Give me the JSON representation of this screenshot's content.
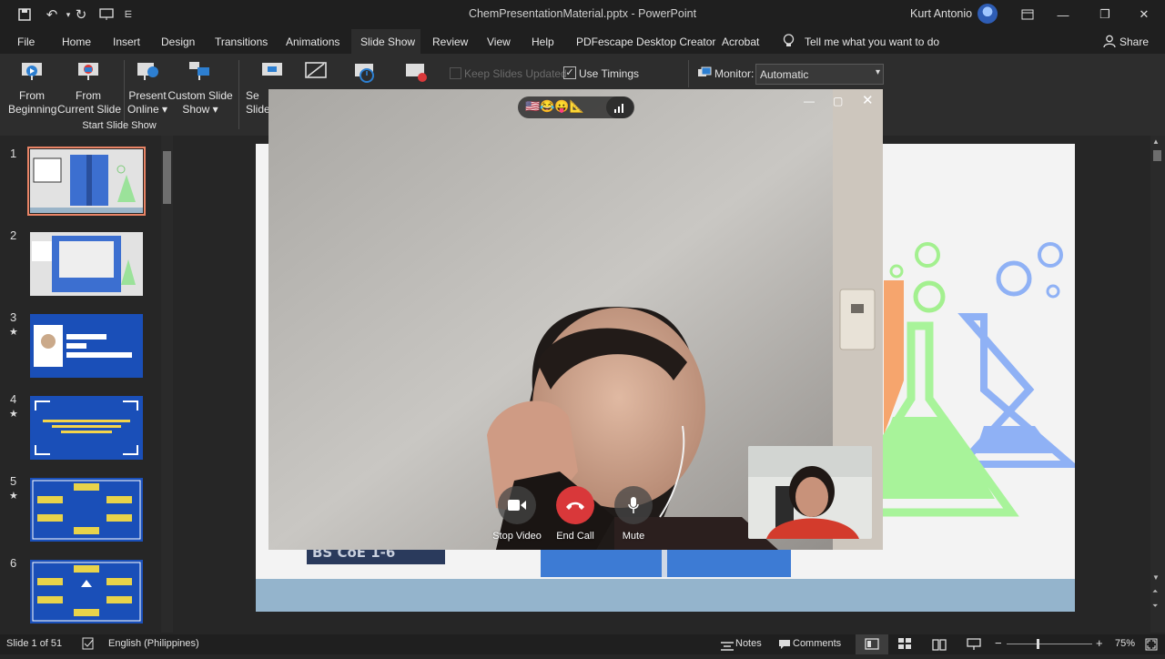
{
  "titlebar": {
    "title": "ChemPresentationMaterial.pptx  -  PowerPoint",
    "user": "Kurt Antonio",
    "minimize": "—",
    "restore": "❐",
    "close": "✕"
  },
  "tabs": [
    "File",
    "Home",
    "Insert",
    "Design",
    "Transitions",
    "Animations",
    "Slide Show",
    "Review",
    "View",
    "Help",
    "PDFescape Desktop Creator",
    "Acrobat"
  ],
  "tell_me": "Tell me what you want to do",
  "share": "Share",
  "ribbon": {
    "from_beginning": [
      "From",
      "Beginning"
    ],
    "from_current": [
      "From",
      "Current Slide"
    ],
    "present_online": [
      "Present",
      "Online ▾"
    ],
    "custom_show": [
      "Custom Slide",
      "Show ▾"
    ],
    "setup": [
      "Se",
      "Slide"
    ],
    "group_label": "Start Slide Show",
    "keep_updated": "Keep Slides Updated",
    "use_timings": "Use Timings",
    "monitor_label": "Monitor:",
    "monitor_value": "Automatic"
  },
  "slides": [
    {
      "num": "1",
      "star": ""
    },
    {
      "num": "2",
      "star": ""
    },
    {
      "num": "3",
      "star": "★"
    },
    {
      "num": "4",
      "star": "★"
    },
    {
      "num": "5",
      "star": "★"
    },
    {
      "num": "6",
      "star": ""
    }
  ],
  "slide_content": {
    "caption": "BS CoE 1-6"
  },
  "call": {
    "reactions": "🇺🇸😂😛📐",
    "stop_video": "Stop Video",
    "end_call": "End Call",
    "mute": "Mute"
  },
  "status": {
    "slide_of": "Slide 1 of 51",
    "language": "English (Philippines)",
    "notes": "Notes",
    "comments": "Comments",
    "zoom": "75%"
  },
  "colors": {
    "accent": "#e98466",
    "end_call": "#d9383a",
    "slide_blue": "#1a4fb8"
  }
}
